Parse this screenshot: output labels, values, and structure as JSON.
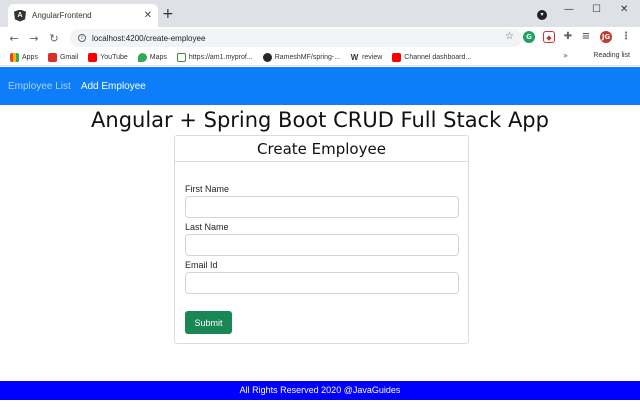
{
  "browser": {
    "tab_title": "AngularFrontend",
    "tab_close": "✕",
    "new_tab": "+",
    "url": "localhost:4200/create-employee",
    "profile_initials": "JG",
    "bookmarks": [
      {
        "label": "Apps",
        "color": "#ea4335"
      },
      {
        "label": "Gmail",
        "color": "#d93025"
      },
      {
        "label": "YouTube",
        "color": "#ff0000"
      },
      {
        "label": "Maps",
        "color": "#34a853"
      },
      {
        "label": "https://am1.myprof...",
        "color": "#3c8c3c"
      },
      {
        "label": "RameshMF/spring-...",
        "color": "#24292e"
      },
      {
        "label": "review",
        "color": "#555555"
      },
      {
        "label": "Channel dashboard...",
        "color": "#ff0000"
      }
    ],
    "reading_list": "Reading list",
    "more": "»"
  },
  "nav": {
    "employee_list": "Employee List",
    "add_employee": "Add Employee"
  },
  "page": {
    "heading": "Angular + Spring Boot CRUD Full Stack App",
    "card_title": "Create Employee",
    "fields": [
      {
        "label": "First Name",
        "value": "",
        "placeholder": ""
      },
      {
        "label": "Last Name",
        "value": "",
        "placeholder": ""
      },
      {
        "label": "Email Id",
        "value": "",
        "placeholder": ""
      }
    ],
    "submit_label": "Submit"
  },
  "footer": {
    "text": "All Rights Reserved 2020 @JavaGuides"
  },
  "colors": {
    "nav_bg": "#0d7df9",
    "footer_bg": "#0000ff",
    "submit_bg": "#198754"
  }
}
